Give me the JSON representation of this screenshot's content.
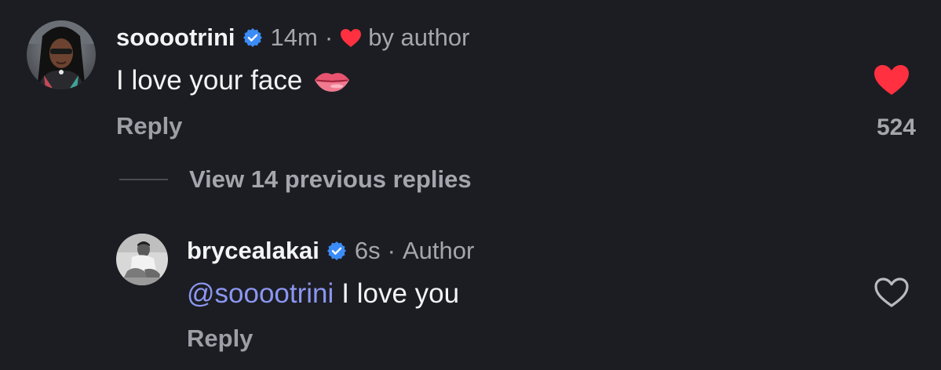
{
  "comments": [
    {
      "username": "sooootrini",
      "verified": true,
      "time": "14m",
      "separator": "·",
      "liked_by": "by author",
      "text": "I love your face",
      "emoji": "lips-emoji",
      "reply_label": "Reply",
      "liked": true,
      "like_count": "524"
    }
  ],
  "view_replies_label": "View 14 previous replies",
  "replies": [
    {
      "username": "brycealakai",
      "verified": true,
      "time": "6s",
      "separator": "·",
      "role": "Author",
      "mention": "@sooootrini",
      "text": "I love you",
      "reply_label": "Reply",
      "liked": false
    }
  ],
  "colors": {
    "background": "#1c1d22",
    "verified_blue": "#3b8cf6",
    "like_red": "#ff3040",
    "mention": "#8c96f2",
    "muted": "#a4a6ad"
  },
  "icons": [
    "verified-badge-icon",
    "heart-filled-icon",
    "heart-outline-icon",
    "lips-emoji"
  ]
}
